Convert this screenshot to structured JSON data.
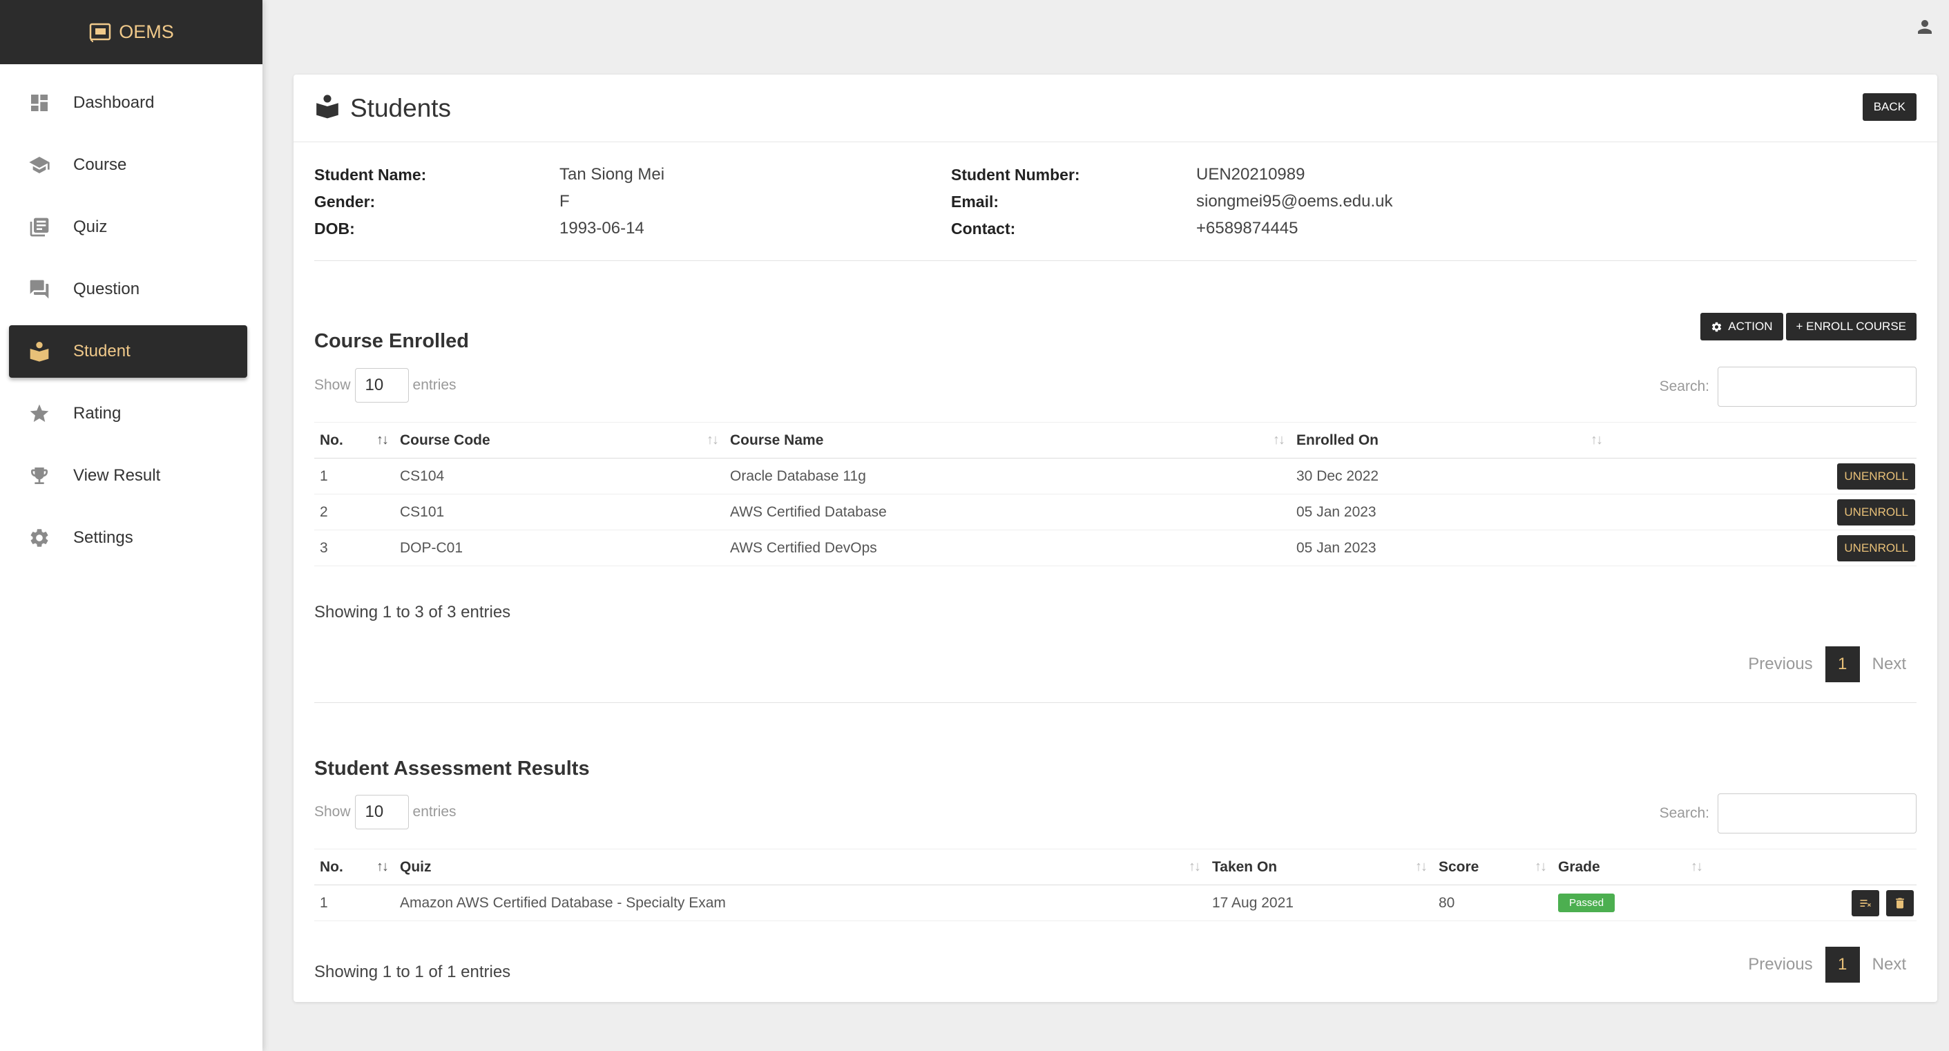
{
  "brand": {
    "name": "OEMS"
  },
  "sidebar": {
    "items": [
      {
        "label": "Dashboard",
        "icon": "dashboard-icon"
      },
      {
        "label": "Course",
        "icon": "graduation-cap-icon"
      },
      {
        "label": "Quiz",
        "icon": "library-books-icon"
      },
      {
        "label": "Question",
        "icon": "forum-icon"
      },
      {
        "label": "Student",
        "icon": "book-reader-icon",
        "active": true
      },
      {
        "label": "Rating",
        "icon": "star-icon"
      },
      {
        "label": "View Result",
        "icon": "trophy-icon"
      },
      {
        "label": "Settings",
        "icon": "gear-icon"
      }
    ]
  },
  "header": {
    "title": "Students",
    "back_label": "BACK"
  },
  "student": {
    "name_label": "Student Name:",
    "name": "Tan Siong Mei",
    "gender_label": "Gender:",
    "gender": "F",
    "dob_label": "DOB:",
    "dob": "1993-06-14",
    "number_label": "Student Number:",
    "number": "UEN20210989",
    "email_label": "Email:",
    "email": "siongmei95@oems.edu.uk",
    "contact_label": "Contact:",
    "contact": "+6589874445"
  },
  "enrolled": {
    "title": "Course Enrolled",
    "action_label": "ACTION",
    "enroll_label": "+ ENROLL COURSE",
    "show_label": "Show",
    "show_value": "10",
    "entries_label": "entries",
    "search_label": "Search:",
    "columns": [
      "No.",
      "Course Code",
      "Course Name",
      "Enrolled On"
    ],
    "rows": [
      {
        "no": "1",
        "code": "CS104",
        "name": "Oracle Database 11g",
        "date": "30 Dec 2022",
        "btn": "UNENROLL"
      },
      {
        "no": "2",
        "code": "CS101",
        "name": "AWS Certified Database",
        "date": "05 Jan 2023",
        "btn": "UNENROLL"
      },
      {
        "no": "3",
        "code": "DOP-C01",
        "name": "AWS Certified DevOps",
        "date": "05 Jan 2023",
        "btn": "UNENROLL"
      }
    ],
    "showing": "Showing 1 to 3 of 3 entries",
    "prev": "Previous",
    "page": "1",
    "next": "Next"
  },
  "results": {
    "title": "Student Assessment Results",
    "show_label": "Show",
    "show_value": "10",
    "entries_label": "entries",
    "search_label": "Search:",
    "columns": [
      "No.",
      "Quiz",
      "Taken On",
      "Score",
      "Grade"
    ],
    "rows": [
      {
        "no": "1",
        "quiz": "Amazon AWS Certified Database - Specialty Exam",
        "date": "17 Aug 2021",
        "score": "80",
        "grade": "Passed"
      }
    ],
    "showing": "Showing 1 to 1 of 1 entries",
    "prev": "Previous",
    "page": "1",
    "next": "Next"
  },
  "colors": {
    "accent": "#e8c078",
    "dark": "#2b2b2b",
    "passed": "#4caf50"
  }
}
